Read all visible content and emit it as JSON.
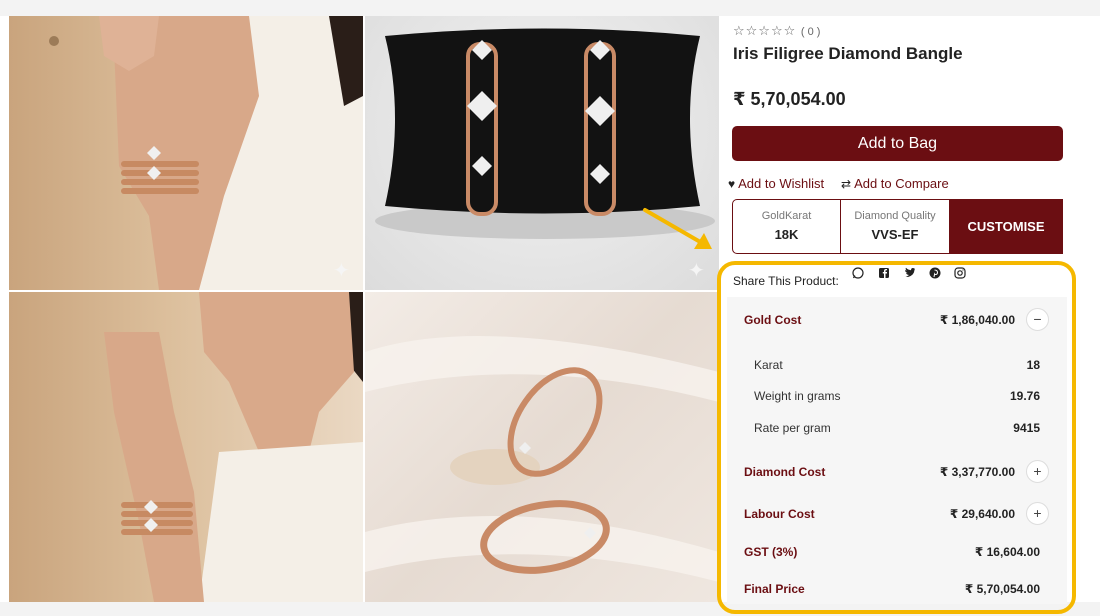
{
  "product": {
    "rating_stars": "☆☆☆☆☆",
    "review_count": "( 0 )",
    "title": "Iris Filigree Diamond Bangle",
    "price": "₹ 5,70,054.00",
    "add_to_bag_label": "Add to Bag",
    "wishlist_label": "Add to Wishlist",
    "compare_label": "Add to Compare"
  },
  "options": [
    {
      "label": "GoldKarat",
      "value": "18K"
    },
    {
      "label": "Diamond Quality",
      "value": "VVS-EF"
    }
  ],
  "customise_label": "CUSTOMISE",
  "share": {
    "label": "Share This Product:",
    "icons": [
      "whatsapp-icon",
      "facebook-icon",
      "twitter-icon",
      "pinterest-icon",
      "instagram-icon"
    ]
  },
  "breakdown": {
    "gold_cost": {
      "label": "Gold Cost",
      "value": "₹ 1,86,040.00",
      "toggle": "−"
    },
    "karat": {
      "label": "Karat",
      "value": "18"
    },
    "weight": {
      "label": "Weight in grams",
      "value": "19.76"
    },
    "rate": {
      "label": "Rate per gram",
      "value": "9415"
    },
    "diamond_cost": {
      "label": "Diamond Cost",
      "value": "₹ 3,37,770.00",
      "toggle": "+"
    },
    "labour_cost": {
      "label": "Labour Cost",
      "value": "₹ 29,640.00",
      "toggle": "+"
    },
    "gst": {
      "label": "GST (3%)",
      "value": "₹ 16,604.00"
    },
    "final_price": {
      "label": "Final Price",
      "value": "₹ 5,70,054.00"
    }
  },
  "colors": {
    "brand": "#6b0e12",
    "highlight": "#f5b800"
  }
}
